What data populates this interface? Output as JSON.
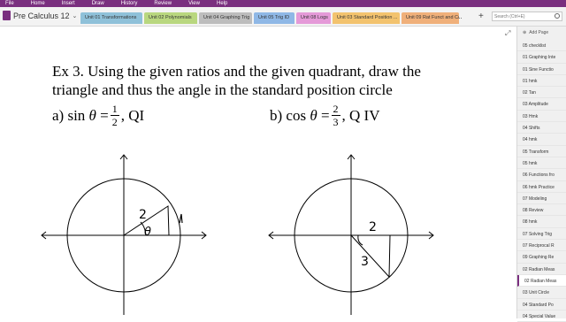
{
  "menu": [
    "File",
    "Home",
    "Insert",
    "Draw",
    "History",
    "Review",
    "View",
    "Help"
  ],
  "notebook": {
    "title": "Pre Calculus 12"
  },
  "tabs": [
    {
      "label": "Unit 01 Transformations",
      "color": "#8fc1d9"
    },
    {
      "label": "Unit 02 Polynomials",
      "color": "#b9d77f"
    },
    {
      "label": "Unit 04 Graphing Trig",
      "color": "#bdbdbd"
    },
    {
      "label": "Unit 05 Trig ID",
      "color": "#8fb8e6"
    },
    {
      "label": "Unit 08 Logs",
      "color": "#e59ad8"
    },
    {
      "label": "Unit 03 Standard Position ...",
      "color": "#f3c36e"
    },
    {
      "label": "Unit 09 Rat Funct and Co...",
      "color": "#f0b07a"
    }
  ],
  "tab_more": "...",
  "tab_add": "+",
  "search": {
    "placeholder": "Search (Ctrl+E)"
  },
  "content": {
    "heading_line1": "Ex 3. Using the given ratios and the given quadrant, draw the",
    "heading_line2": "triangle and thus the angle in the standard position circle",
    "part_a": {
      "prefix": "a) sin",
      "theta": "θ",
      "eq": "=",
      "num": "1",
      "den": "2",
      "suffix": ", QI"
    },
    "part_b": {
      "prefix": "b) cos",
      "theta": "θ",
      "eq": "=",
      "num": "2",
      "den": "3",
      "suffix": ", Q IV"
    },
    "handwriting": {
      "a_hyp": "2",
      "a_theta": "θ",
      "b_adj": "2",
      "b_hyp": "3"
    }
  },
  "pages_panel": {
    "add_page": "Add Page",
    "items": [
      "05 checklist",
      "01 Graphing Inte",
      "01 Sine Functio",
      "01 hmk",
      "02 Tan",
      "03 Amplitude",
      "03 Hmk",
      "04 Shifts",
      "04 hmk",
      "05 Transform",
      "05 hmk",
      "06 Functions fro",
      "06 hmk Practice",
      "07 Modeling",
      "08 Review",
      "08 hmk",
      "07 Solving Trig",
      "07 Reciprocal R",
      "09 Graphing Re",
      "02 Radian Meas",
      "02 Radian Meas",
      "03 Unit Circle",
      "04 Standard Po",
      "04 Special Value"
    ],
    "active_index": 20
  }
}
